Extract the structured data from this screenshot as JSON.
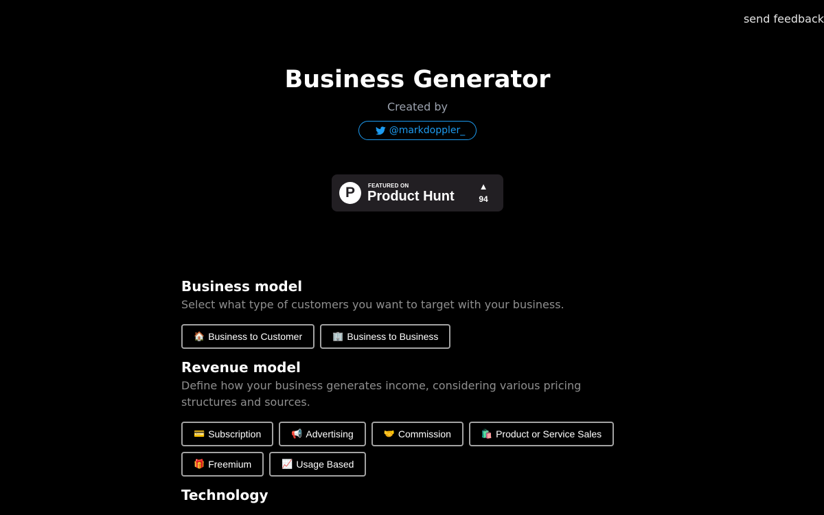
{
  "header": {
    "feedback_label": "send feedback"
  },
  "hero": {
    "title": "Business Generator",
    "created_by": "Created by",
    "twitter_handle": "@markdoppler_",
    "twitter_icon": "twitter-icon"
  },
  "product_hunt": {
    "featured_label": "FEATURED ON",
    "name": "Product Hunt",
    "logo_letter": "P",
    "upvote_arrow": "▲",
    "upvotes": "94"
  },
  "sections": [
    {
      "title": "Business model",
      "description": "Select what type of customers you want to target with your business.",
      "options": [
        {
          "emoji": "🏠",
          "label": "Business to Customer"
        },
        {
          "emoji": "🏢",
          "label": "Business to Business"
        }
      ]
    },
    {
      "title": "Revenue model",
      "description": "Define how your business generates income, considering various pricing structures and sources.",
      "options": [
        {
          "emoji": "💳",
          "label": "Subscription"
        },
        {
          "emoji": "📢",
          "label": "Advertising"
        },
        {
          "emoji": "🤝",
          "label": "Commission"
        },
        {
          "emoji": "🛍️",
          "label": "Product or Service Sales"
        },
        {
          "emoji": "🎁",
          "label": "Freemium"
        },
        {
          "emoji": "📈",
          "label": "Usage Based"
        }
      ]
    },
    {
      "title": "Technology"
    }
  ],
  "colors": {
    "background": "#000000",
    "twitter_blue": "#1d9bf0",
    "badge_bg": "#221f23",
    "muted_text": "#8f8f8f",
    "option_border": "#a3a3a3"
  }
}
